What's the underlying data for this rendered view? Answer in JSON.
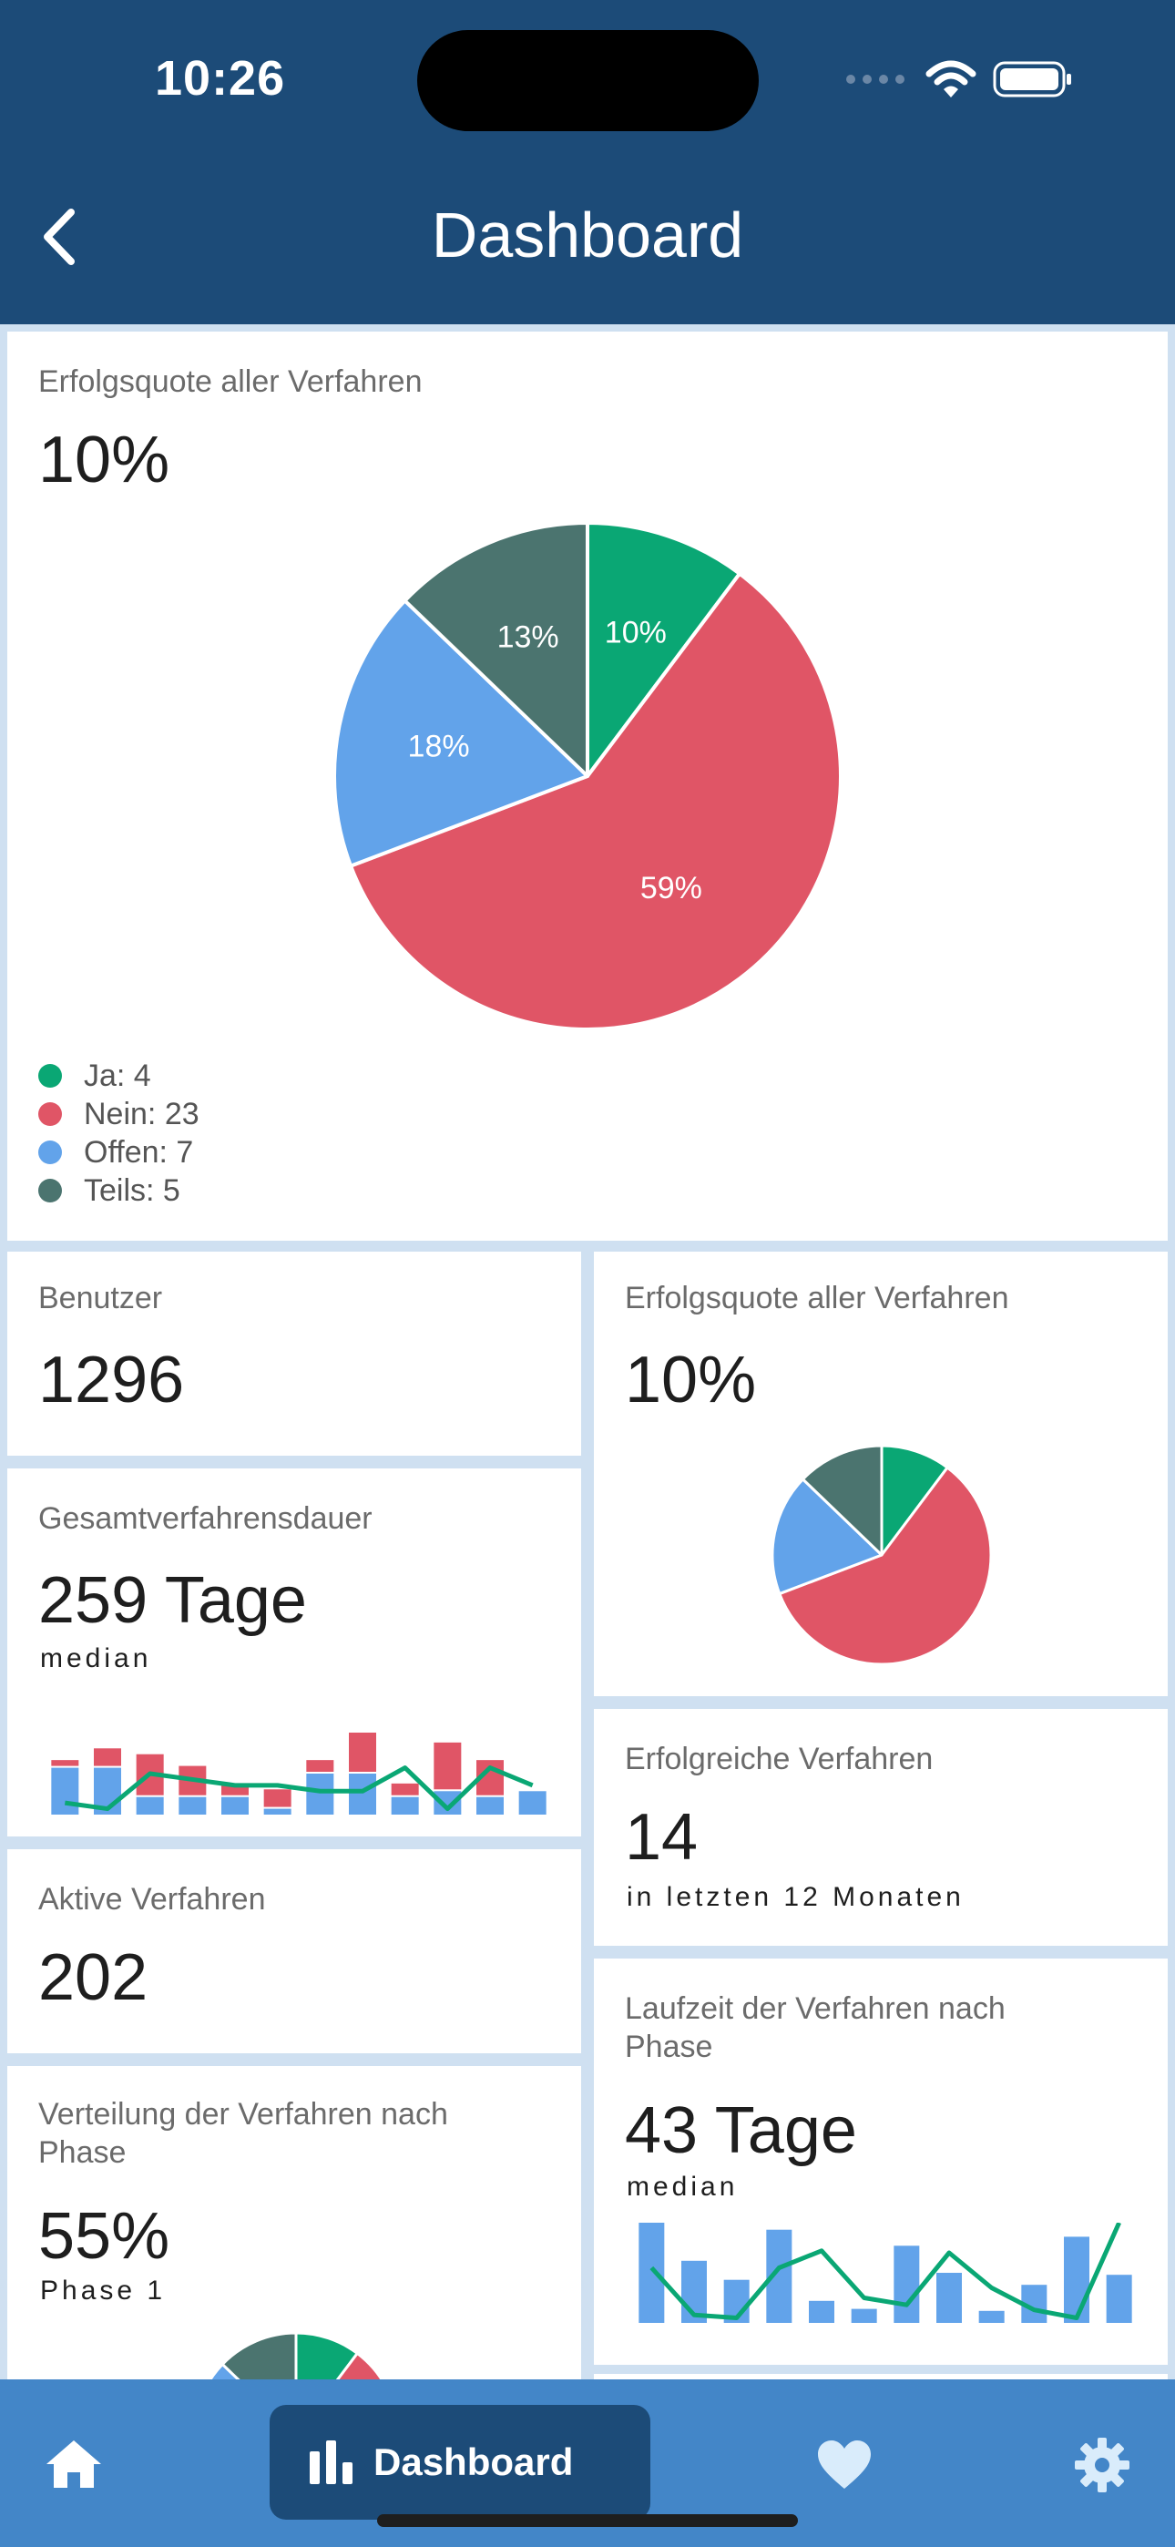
{
  "status_bar": {
    "time": "10:26"
  },
  "header": {
    "title": "Dashboard"
  },
  "success_rate_card": {
    "label": "Erfolgsquote aller Verfahren",
    "value": "10%",
    "legend": [
      {
        "text": "Ja: 4",
        "color": "#0aa774"
      },
      {
        "text": "Nein: 23",
        "color": "#e05566"
      },
      {
        "text": "Offen: 7",
        "color": "#62a3ea"
      },
      {
        "text": "Teils: 5",
        "color": "#4b746f"
      }
    ]
  },
  "chart_data": [
    {
      "type": "pie",
      "categories": [
        "Ja",
        "Nein",
        "Offen",
        "Teils"
      ],
      "values": [
        4,
        23,
        7,
        5
      ],
      "slice_labels": [
        "10%",
        "59%",
        "18%",
        "13%"
      ],
      "colors": [
        "#0aa774",
        "#e05566",
        "#62a3ea",
        "#4b746f"
      ]
    },
    {
      "type": "pie",
      "categories": [
        "Ja",
        "Nein",
        "Offen",
        "Teils"
      ],
      "values": [
        4,
        23,
        7,
        5
      ],
      "colors": [
        "#0aa774",
        "#e05566",
        "#62a3ea",
        "#4b746f"
      ]
    },
    {
      "type": "bar",
      "series": [
        {
          "values": [
            40,
            40,
            15,
            15,
            15,
            5,
            35,
            35,
            15,
            20,
            15,
            20
          ],
          "color": "#62a3ea"
        },
        {
          "values": [
            5,
            15,
            35,
            25,
            10,
            15,
            10,
            35,
            10,
            40,
            30,
            0
          ],
          "color": "#e05566"
        }
      ],
      "line": {
        "values": [
          10,
          5,
          35,
          30,
          25,
          25,
          20,
          20,
          40,
          5,
          40,
          25
        ],
        "color": "#0aa774"
      },
      "ylim": [
        0,
        70
      ]
    },
    {
      "type": "bar",
      "series": [
        {
          "values": [
            100,
            62,
            43,
            93,
            22,
            14,
            77,
            50,
            12,
            38,
            86,
            48
          ],
          "color": "#62a3ea"
        }
      ],
      "line": {
        "values": [
          55,
          8,
          5,
          55,
          72,
          25,
          18,
          70,
          35,
          13,
          5,
          100
        ],
        "color": "#0aa774"
      },
      "ylim": [
        0,
        100
      ]
    },
    {
      "type": "pie",
      "categories": [
        "Ja",
        "Nein",
        "Offen",
        "Teils"
      ],
      "values": [
        4,
        23,
        7,
        5
      ],
      "colors": [
        "#0aa774",
        "#e05566",
        "#62a3ea",
        "#4b746f"
      ]
    }
  ],
  "users_card": {
    "label": "Benutzer",
    "value": "1296"
  },
  "success_rate_small_card": {
    "label": "Erfolgsquote aller Verfahren",
    "value": "10%"
  },
  "duration_card": {
    "label": "Gesamtverfahrensdauer",
    "value": "259 Tage",
    "sub": "median"
  },
  "successful_card": {
    "label": "Erfolgreiche Verfahren",
    "value": "14",
    "sub": "in letzten 12 Monaten"
  },
  "active_card": {
    "label": "Aktive Verfahren",
    "value": "202"
  },
  "runtime_card": {
    "label_line1": "Laufzeit der Verfahren nach",
    "label_line2": "Phase",
    "value": "43 Tage",
    "sub": "median"
  },
  "distribution_card": {
    "label_line1": "Verteilung der Verfahren nach",
    "label_line2": "Phase",
    "value": "55%",
    "sub": "Phase 1"
  },
  "bottom_nav": {
    "active_label": "Dashboard"
  }
}
